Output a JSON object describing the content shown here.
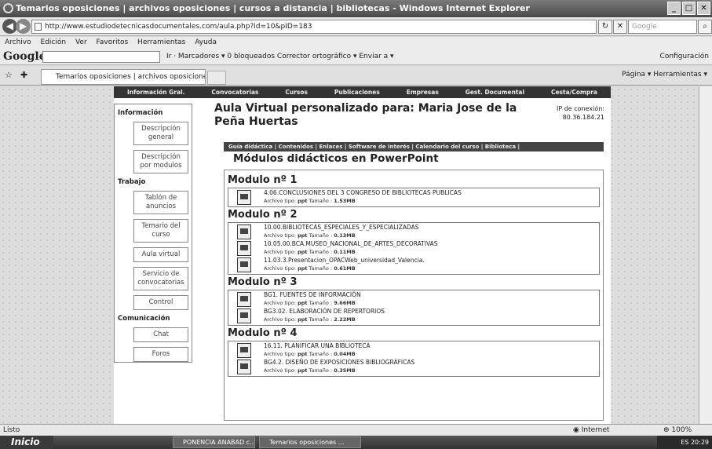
{
  "window": {
    "title": "Temarios oposiciones | archivos oposiciones | cursos a distancia | bibliotecas - Windows Internet Explorer"
  },
  "address": {
    "url": "http://www.estudiodetecnicasdocumentales.com/aula.php?id=10&pID=183",
    "search_placeholder": "Google"
  },
  "menu": [
    "Archivo",
    "Edición",
    "Ver",
    "Favoritos",
    "Herramientas",
    "Ayuda"
  ],
  "google_toolbar": {
    "logo": "Google",
    "items": "Ir  ·  Marcadores ▾   0 bloqueados   Corrector ortográfico ▾   Enviar a ▾",
    "config": "Configuración"
  },
  "tabs": {
    "current": "Temarios oposiciones | archivos oposiciones | cursos a...",
    "right_tools": "Página ▾   Herramientas ▾"
  },
  "site": {
    "topnav": [
      "Información Gral.",
      "Convocatorias",
      "Cursos",
      "Publicaciones",
      "Empresas",
      "Gest. Documental",
      "Cesta/Compra"
    ],
    "page_title": "Aula Virtual personalizado para: Maria Jose de la Peña Huertas",
    "ip_label": "IP de conexión:",
    "ip_value": "80.36.184.21",
    "left": {
      "info_head": "Información",
      "info": [
        "Descripción general",
        "Descripción por modulos"
      ],
      "trabajo_head": "Trabajo",
      "trabajo": [
        "Tablón de anuncios",
        "Temario del curso",
        "Aula virtual",
        "Servicio de convocatorias",
        "Control"
      ],
      "com_head": "Comunicación",
      "com": [
        "Chat",
        "Foros"
      ]
    },
    "subnav": "Guía didáctica  |  Contenidos  |  Enlaces  |  Software de interés  |  Calendario del curso  |  Biblioteca  |",
    "modules_title": "Módulos didácticos en PowerPoint",
    "file_type_label": "Archivo tipo:",
    "size_label": "Tamaño :",
    "modules": [
      {
        "name": "Modulo nº 1",
        "files": [
          {
            "name": "4.06.CONCLUSIONES DEL 3 CONGRESO DE BIBLIOTECAS PUBLICAS",
            "type": "ppt",
            "size": "1.53MB"
          }
        ]
      },
      {
        "name": "Modulo nº 2",
        "files": [
          {
            "name": "10.00.BIBLIOTECAS_ESPECIALES_Y_ESPECIALIZADAS",
            "type": "ppt",
            "size": "0.13MB"
          },
          {
            "name": "10.05.00.BCA.MUSEO_NACIONAL_DE_ARTES_DECORATIVAS",
            "type": "ppt",
            "size": "0.11MB"
          },
          {
            "name": "11.03.3.Presentacion_OPACWeb_universidad_Valencia.",
            "type": "ppt",
            "size": "0.61MB"
          }
        ]
      },
      {
        "name": "Modulo nº 3",
        "files": [
          {
            "name": "BG1. FUENTES DE INFORMACIÓN",
            "type": "ppt",
            "size": "9.66MB"
          },
          {
            "name": "BG3.02. ELABORACIÓN DE REPERTORIOS",
            "type": "ppt",
            "size": "2.22MB"
          }
        ]
      },
      {
        "name": "Modulo nº 4",
        "files": [
          {
            "name": "16.11. PLANIFICAR UNA BIBLIOTECA",
            "type": "ppt",
            "size": "0.04MB"
          },
          {
            "name": "BG4.2. DISEÑO DE EXPOSICIONES BIBLIOGRÁFICAS",
            "type": "ppt",
            "size": "0.35MB"
          }
        ]
      }
    ]
  },
  "status": {
    "text": "Listo",
    "zone": "Internet",
    "zoom": "100%"
  },
  "taskbar": {
    "start": "Inicio",
    "items": [
      "PONENCIA ANABAD c...",
      "Temarios oposiciones ..."
    ],
    "tray": "ES  20:29"
  }
}
